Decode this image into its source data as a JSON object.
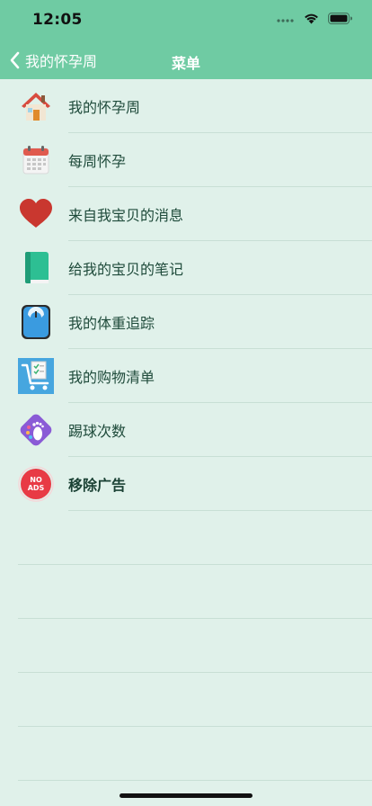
{
  "status_bar": {
    "time": "12:05"
  },
  "nav": {
    "back_label": "我的怀孕周",
    "title": "菜单"
  },
  "menu": {
    "items": [
      {
        "label": "我的怀孕周",
        "icon": "house-icon"
      },
      {
        "label": "每周怀孕",
        "icon": "calendar-icon"
      },
      {
        "label": "来自我宝贝的消息",
        "icon": "heart-icon"
      },
      {
        "label": "给我的宝贝的笔记",
        "icon": "notebook-icon"
      },
      {
        "label": "我的体重追踪",
        "icon": "scale-icon"
      },
      {
        "label": "我的购物清单",
        "icon": "shopping-cart-icon"
      },
      {
        "label": "踢球次数",
        "icon": "footprint-icon"
      },
      {
        "label": "移除广告",
        "icon": "no-ads-icon",
        "icon_text": "NO ADS"
      }
    ]
  },
  "colors": {
    "header": "#6fcba3",
    "background": "#e0f1ea",
    "separator": "#c8dfd5",
    "label": "#1f4b3b"
  }
}
